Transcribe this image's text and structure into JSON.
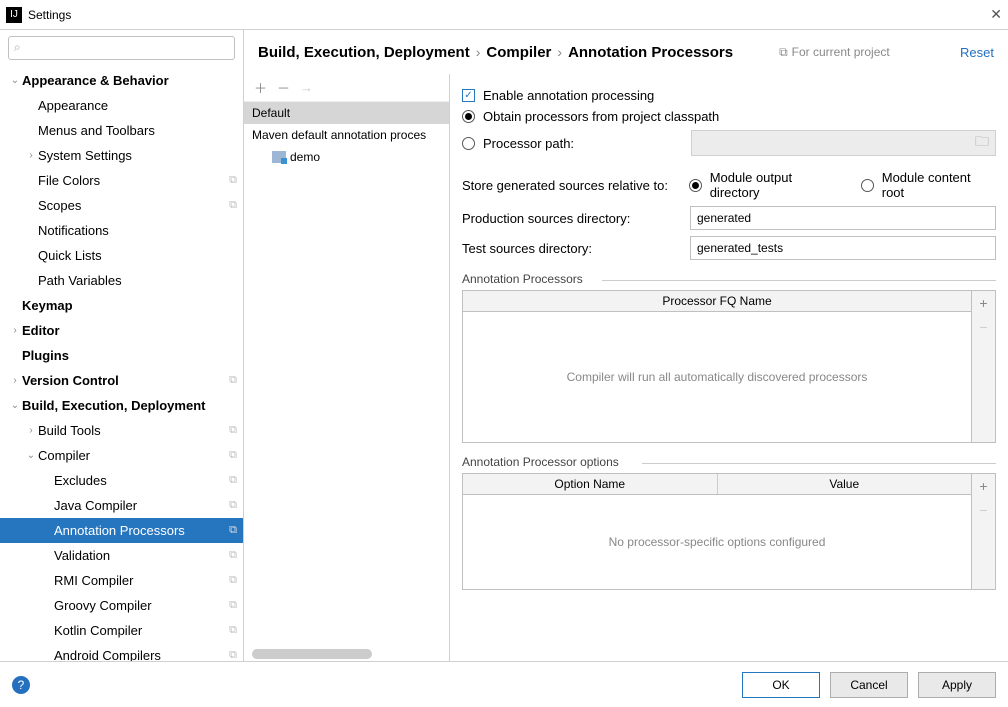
{
  "window": {
    "title": "Settings"
  },
  "sidebar": {
    "search_placeholder": "",
    "items": [
      {
        "label": "Appearance & Behavior",
        "bold": true,
        "chev": "v",
        "indent": 0
      },
      {
        "label": "Appearance",
        "indent": 1
      },
      {
        "label": "Menus and Toolbars",
        "indent": 1
      },
      {
        "label": "System Settings",
        "indent": 1,
        "chev": ">"
      },
      {
        "label": "File Colors",
        "indent": 1,
        "badge": true
      },
      {
        "label": "Scopes",
        "indent": 1,
        "badge": true
      },
      {
        "label": "Notifications",
        "indent": 1
      },
      {
        "label": "Quick Lists",
        "indent": 1
      },
      {
        "label": "Path Variables",
        "indent": 1
      },
      {
        "label": "Keymap",
        "bold": true,
        "indent": 0
      },
      {
        "label": "Editor",
        "bold": true,
        "indent": 0,
        "chev": ">"
      },
      {
        "label": "Plugins",
        "bold": true,
        "indent": 0
      },
      {
        "label": "Version Control",
        "bold": true,
        "indent": 0,
        "chev": ">",
        "badge": true
      },
      {
        "label": "Build, Execution, Deployment",
        "bold": true,
        "indent": 0,
        "chev": "v"
      },
      {
        "label": "Build Tools",
        "indent": 1,
        "chev": ">",
        "badge": true
      },
      {
        "label": "Compiler",
        "indent": 1,
        "chev": "v",
        "badge": true
      },
      {
        "label": "Excludes",
        "indent": 2,
        "badge": true
      },
      {
        "label": "Java Compiler",
        "indent": 2,
        "badge": true
      },
      {
        "label": "Annotation Processors",
        "indent": 2,
        "badge": true,
        "selected": true
      },
      {
        "label": "Validation",
        "indent": 2,
        "badge": true
      },
      {
        "label": "RMI Compiler",
        "indent": 2,
        "badge": true
      },
      {
        "label": "Groovy Compiler",
        "indent": 2,
        "badge": true
      },
      {
        "label": "Kotlin Compiler",
        "indent": 2,
        "badge": true
      },
      {
        "label": "Android Compilers",
        "indent": 2,
        "badge": true
      }
    ]
  },
  "crumbs": {
    "a": "Build, Execution, Deployment",
    "b": "Compiler",
    "c": "Annotation Processors",
    "tag": "For current project",
    "reset": "Reset"
  },
  "profiles": {
    "default": "Default",
    "maven": "Maven default annotation proces",
    "demo": "demo"
  },
  "form": {
    "enable": "Enable annotation processing",
    "obtain": "Obtain processors from project classpath",
    "procpath": "Processor path:",
    "store": "Store generated sources relative to:",
    "module_out": "Module output directory",
    "module_content": "Module content root",
    "prod_dir_label": "Production sources directory:",
    "prod_dir_value": "generated",
    "test_dir_label": "Test sources directory:",
    "test_dir_value": "generated_tests",
    "fs1": "Annotation Processors",
    "th1": "Processor FQ Name",
    "empty1": "Compiler will run all automatically discovered processors",
    "fs2": "Annotation Processor options",
    "th2a": "Option Name",
    "th2b": "Value",
    "empty2": "No processor-specific options configured"
  },
  "footer": {
    "ok": "OK",
    "cancel": "Cancel",
    "apply": "Apply"
  }
}
